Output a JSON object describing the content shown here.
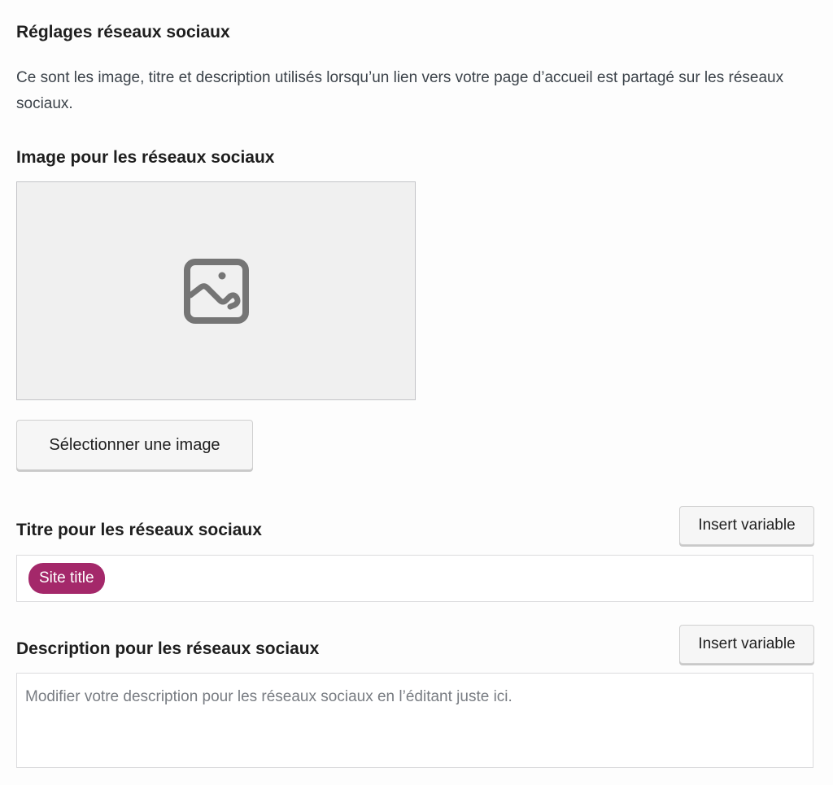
{
  "section": {
    "title": "Réglages réseaux sociaux",
    "description": "Ce sont les image, titre et description utilisés lorsqu’un lien vers votre page d’accueil est partagé sur les réseaux sociaux."
  },
  "image_field": {
    "label": "Image pour les réseaux sociaux",
    "placeholder_icon": "image-icon",
    "select_button": "Sélectionner une image"
  },
  "title_field": {
    "label": "Titre pour les réseaux sociaux",
    "insert_variable_button": "Insert variable",
    "tags": [
      "Site title"
    ]
  },
  "description_field": {
    "label": "Description pour les réseaux sociaux",
    "insert_variable_button": "Insert variable",
    "placeholder": "Modifier votre description pour les réseaux sociaux en l’éditant juste ici."
  },
  "colors": {
    "tag_background": "#a4286a",
    "placeholder_background": "#f0f0f0",
    "icon": "#757575"
  }
}
